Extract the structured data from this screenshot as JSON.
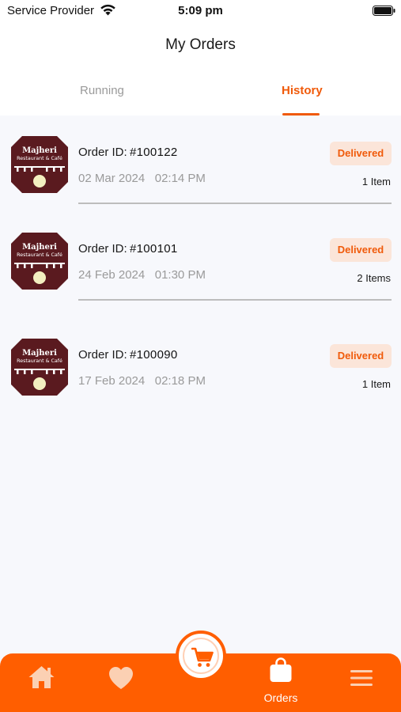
{
  "status_bar": {
    "carrier": "Service Provider",
    "time": "5:09 pm",
    "wifi_icon": "wifi-icon",
    "battery_icon": "battery-icon"
  },
  "header": {
    "title": "My Orders"
  },
  "tabs": [
    {
      "label": "Running",
      "active": false
    },
    {
      "label": "History",
      "active": true
    }
  ],
  "orders": [
    {
      "logo_text": "Majheri",
      "logo_subtext": "Restaurant & Café",
      "id_label": "Order ID:",
      "id": "#100122",
      "date": "02 Mar 2024   02:14 PM",
      "status": "Delivered",
      "items": "1 Item"
    },
    {
      "logo_text": "Majheri",
      "logo_subtext": "Restaurant & Café",
      "id_label": "Order ID:",
      "id": "#100101",
      "date": "24 Feb 2024   01:30 PM",
      "status": "Delivered",
      "items": "2 Items"
    },
    {
      "logo_text": "Majheri",
      "logo_subtext": "Restaurant & Café",
      "id_label": "Order ID:",
      "id": "#100090",
      "date": "17 Feb 2024   02:18 PM",
      "status": "Delivered",
      "items": "1 Item"
    }
  ],
  "bottom_nav": {
    "items": [
      {
        "icon": "home-icon"
      },
      {
        "icon": "heart-icon"
      },
      {
        "icon": "cart-icon"
      },
      {
        "icon": "bag-icon",
        "label": "Orders",
        "active": true
      },
      {
        "icon": "menu-icon"
      }
    ]
  },
  "colors": {
    "accent": "#ff5e00",
    "badge_bg": "#fbe5d9",
    "logo_bg": "#5a1a1f"
  }
}
